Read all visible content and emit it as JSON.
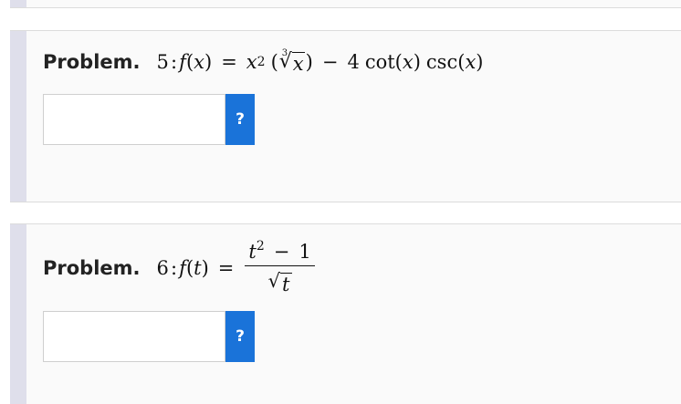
{
  "problems": [
    {
      "label": "Problem.",
      "number": "5",
      "answer_value": "",
      "help_label": "?"
    },
    {
      "label": "Problem.",
      "number": "6",
      "answer_value": "",
      "help_label": "?"
    }
  ],
  "colors": {
    "help_button": "#1a73d9",
    "card_accent": "#dfdfeb",
    "card_background": "#fafafa"
  }
}
